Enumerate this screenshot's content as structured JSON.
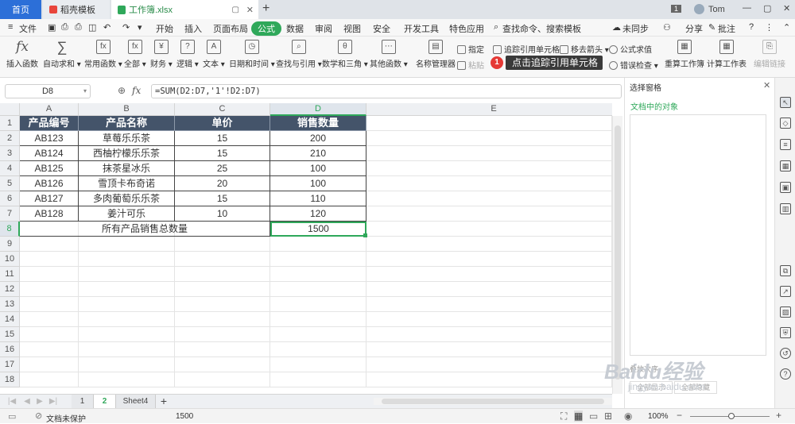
{
  "tabs": {
    "home": "首页",
    "docer": "稻壳模板",
    "file": "工作簿.xlsx",
    "new": "+"
  },
  "titlebar": {
    "page": "1",
    "user": "Tom"
  },
  "menu": {
    "file": "文件",
    "items": [
      "开始",
      "插入",
      "页面布局",
      "公式",
      "数据",
      "审阅",
      "视图",
      "安全",
      "开发工具",
      "特色应用"
    ],
    "active": "公式",
    "search": "查找命令、搜索模板",
    "sync": "未同步",
    "share": "分享",
    "comment": "批注"
  },
  "ribbon": {
    "insert_func": "插入函数",
    "autosum": "自动求和",
    "common": "常用函数",
    "all": "全部",
    "finance": "财务",
    "logic": "逻辑",
    "text": "文本",
    "datetime": "日期和时间",
    "lookup": "查找与引用",
    "math": "数学和三角",
    "other": "其他函数",
    "name_mgr": "名称管理器",
    "specify": "指定",
    "paste": "粘贴",
    "trace_prec": "追踪引用单元格",
    "remove_arrows": "移去箭头",
    "formula_eval": "公式求值",
    "error_check": "错误检查",
    "recalc_book": "重算工作簿",
    "calc_sheet": "计算工作表",
    "edit_link": "编辑链接",
    "tooltip_num": "1",
    "tooltip": "点击追踪引用单元格"
  },
  "formula_bar": {
    "name_box": "D8",
    "fx": "fx",
    "formula": "=SUM(D2:D7,'1'!D2:D7)"
  },
  "columns": [
    "A",
    "B",
    "C",
    "D",
    "E"
  ],
  "rows": [
    "1",
    "2",
    "3",
    "4",
    "5",
    "6",
    "7",
    "8",
    "9",
    "10",
    "11",
    "12",
    "13",
    "14",
    "15",
    "16",
    "17",
    "18"
  ],
  "table": {
    "headers": [
      "产品编号",
      "产品名称",
      "单价",
      "销售数量"
    ],
    "data": [
      [
        "AB123",
        "草莓乐乐茶",
        "15",
        "200"
      ],
      [
        "AB124",
        "西柚柠檬乐乐茶",
        "15",
        "210"
      ],
      [
        "AB125",
        "抹茶星冰乐",
        "25",
        "100"
      ],
      [
        "AB126",
        "雪顶卡布奇诺",
        "20",
        "100"
      ],
      [
        "AB127",
        "多肉葡萄乐乐茶",
        "15",
        "110"
      ],
      [
        "AB128",
        "姜汁可乐",
        "10",
        "120"
      ]
    ],
    "total_label": "所有产品销售总数量",
    "total_value": "1500"
  },
  "sheets": {
    "items": [
      "1",
      "2",
      "Sheet4"
    ],
    "active": "2",
    "add": "+"
  },
  "status": {
    "protect": "文档未保护",
    "sum": "1500",
    "zoom": "100%"
  },
  "taskpane": {
    "title": "选择窗格",
    "objects": "文档中的对象",
    "show_all": "全部显示",
    "hide_all": "全部隐藏",
    "reorder": "叠放次序"
  },
  "watermark": {
    "brand": "Baidu经验",
    "url": "jingyan.baidu.com"
  },
  "colors": {
    "accent": "#2fa85a",
    "header_fill": "#44546a",
    "home_tab": "#2c6fd8",
    "badge": "#e53935"
  }
}
